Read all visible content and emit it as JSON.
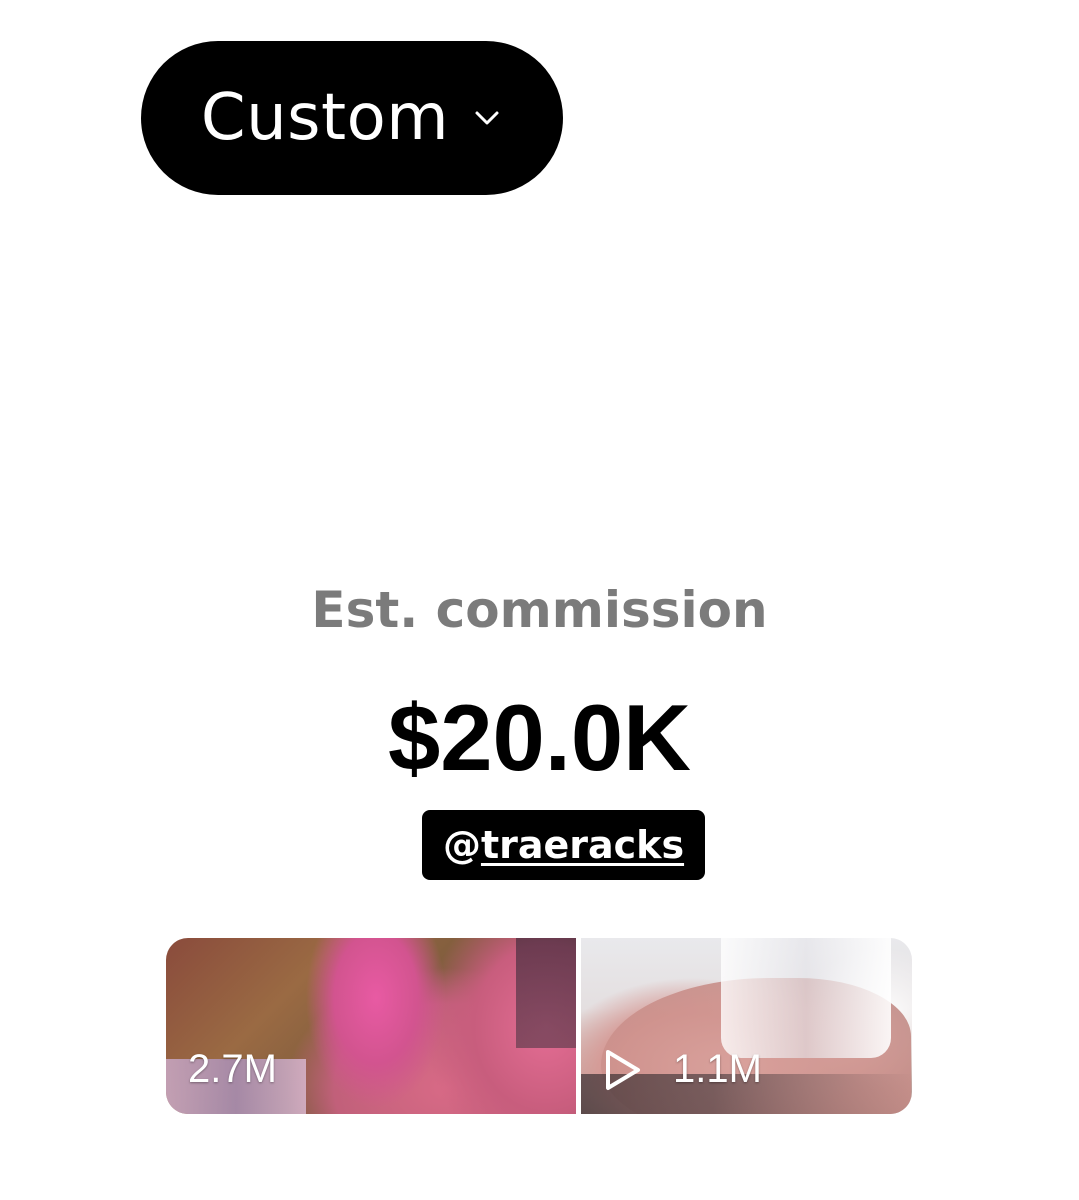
{
  "filter": {
    "label": "Custom",
    "icon": "chevron-down-icon"
  },
  "commission": {
    "label": "Est. commission",
    "value": "$20.0K"
  },
  "mention": {
    "at": "@",
    "handle": "traeracks"
  },
  "videos": [
    {
      "views": "2.7M",
      "icon": ""
    },
    {
      "views": "1.1M",
      "icon": "play-icon"
    }
  ],
  "colors": {
    "background": "#ffffff",
    "pill": "#000000",
    "label_gray": "#7b7b7b",
    "text": "#000000"
  }
}
